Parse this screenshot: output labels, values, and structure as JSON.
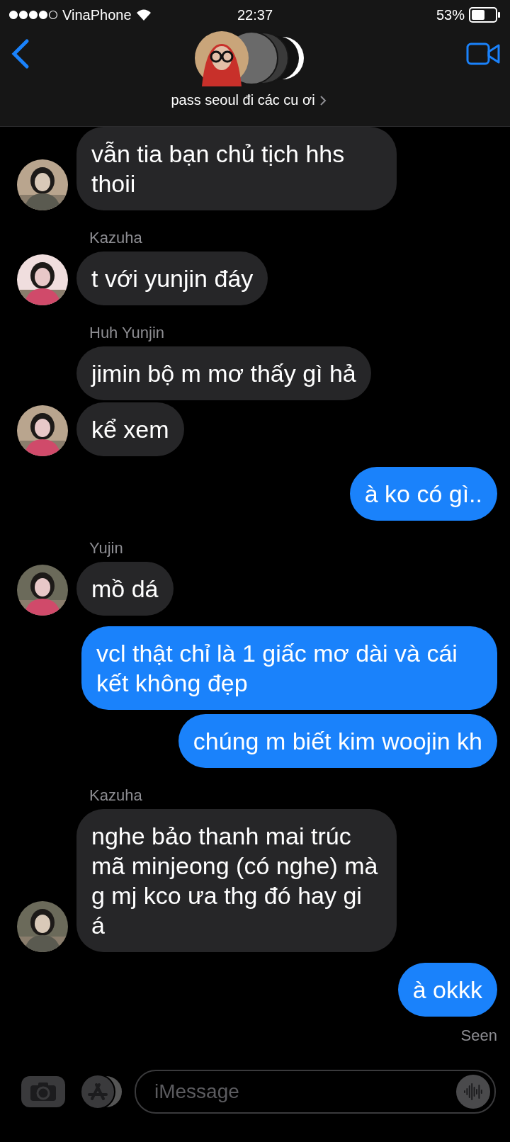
{
  "status_bar": {
    "carrier": "VinaPhone",
    "time": "22:37",
    "battery": "53%"
  },
  "header": {
    "title": "pass seoul đi các cu ơi"
  },
  "messages": [
    {
      "kind": "received",
      "text": "vẫn tia bạn chủ tịch hhs thoii",
      "avatar": true
    },
    {
      "kind": "received",
      "sender": "Kazuha",
      "text": "t với yunjin đáy",
      "avatar": true
    },
    {
      "kind": "received",
      "sender": "Huh Yunjin",
      "text": "jimin bộ m mơ thấy gì hả",
      "avatar": false
    },
    {
      "kind": "received",
      "text": "kể xem",
      "avatar": true
    },
    {
      "kind": "sent",
      "text": "à ko có gì.."
    },
    {
      "kind": "received",
      "sender": "Yujin",
      "text": "mồ dá",
      "avatar": true
    },
    {
      "kind": "sent",
      "text": "vcl thật chỉ là 1 giấc mơ dài và cái kết không đẹp"
    },
    {
      "kind": "sent",
      "text": "chúng m biết kim woojin kh"
    },
    {
      "kind": "received",
      "sender": "Kazuha",
      "text": "nghe bảo thanh mai trúc mã minjeong (có nghe) mà g mj kco ưa thg đó hay gi á",
      "avatar": true
    },
    {
      "kind": "sent",
      "text": "à okkk"
    }
  ],
  "seen": "Seen",
  "composer": {
    "placeholder": "iMessage"
  }
}
